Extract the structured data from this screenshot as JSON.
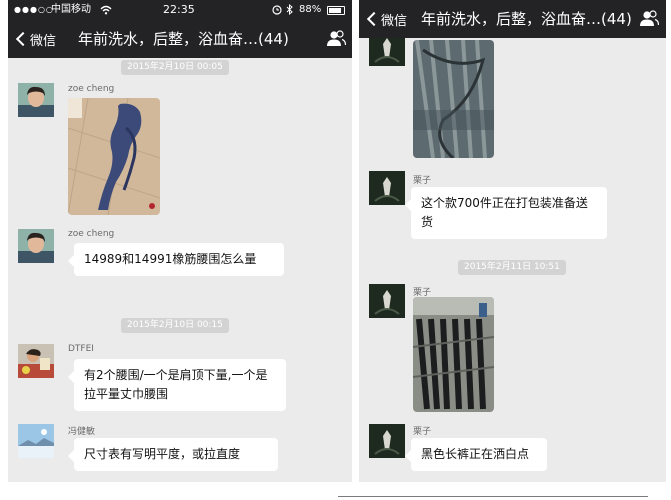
{
  "status_bar": {
    "signal": "●●●○○",
    "carrier": "中国移动",
    "time": "22:35",
    "battery": "88%",
    "battery_level": 0.88
  },
  "nav": {
    "back_label": "微信",
    "title": "年前洗水，后整，浴血奋…(44)"
  },
  "left_chat": {
    "timestamp_1": "2015年2月10日 00:05",
    "msg_1_sender": "zoe cheng",
    "msg_2_sender": "zoe cheng",
    "msg_2_text": "14989和14991橡筋腰围怎么量",
    "timestamp_2": "2015年2月10日 00:15",
    "msg_3_sender": "DTFEI",
    "msg_3_text": "有2个腰围/一个是肩顶下量,一个是拉平量丈巾腰围",
    "msg_4_sender": "冯健敏",
    "msg_4_text": "尺寸表有写明平度，或拉直度"
  },
  "right_chat": {
    "msg_1_sender": "栗子",
    "msg_1_text": "这个款700件正在打包装准备送货",
    "timestamp_1": "2015年2月11日 10:51",
    "msg_2_sender": "栗子",
    "msg_3_sender": "栗子",
    "msg_3_text": "黑色长裤正在洒白点"
  },
  "colors": {
    "header": "#232326",
    "chat_background": "#ebebeb",
    "bubble": "#ffffff"
  },
  "icons": [
    "wifi-icon",
    "alarm-icon",
    "bluetooth-icon",
    "battery-icon",
    "back-chevron-icon",
    "contacts-icon"
  ]
}
